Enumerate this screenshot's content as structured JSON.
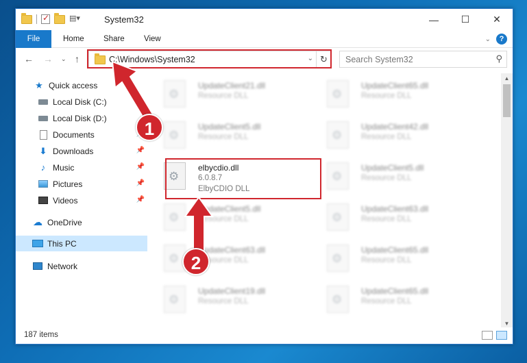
{
  "window": {
    "title": "System32",
    "controls": [
      "minimize-icon",
      "maximize-icon",
      "close-icon"
    ]
  },
  "ribbon": {
    "tabs": [
      "File",
      "Home",
      "Share",
      "View"
    ]
  },
  "address_bar": {
    "path": "C:\\Windows\\System32",
    "search_placeholder": "Search System32"
  },
  "sidebar": {
    "items": [
      {
        "label": "Quick access",
        "icon": "star-icon",
        "pinned": false
      },
      {
        "label": "Local Disk (C:)",
        "icon": "drive-icon",
        "pinned": true
      },
      {
        "label": "Local Disk (D:)",
        "icon": "drive-icon",
        "pinned": false
      },
      {
        "label": "Documents",
        "icon": "documents-icon",
        "pinned": true
      },
      {
        "label": "Downloads",
        "icon": "downloads-icon",
        "pinned": true
      },
      {
        "label": "Music",
        "icon": "music-icon",
        "pinned": true
      },
      {
        "label": "Pictures",
        "icon": "pictures-icon",
        "pinned": true
      },
      {
        "label": "Videos",
        "icon": "videos-icon",
        "pinned": true
      },
      {
        "label": "OneDrive",
        "icon": "cloud-icon",
        "pinned": false
      },
      {
        "label": "This PC",
        "icon": "computer-icon",
        "pinned": false,
        "selected": true
      },
      {
        "label": "Network",
        "icon": "network-icon",
        "pinned": false
      }
    ]
  },
  "files": [
    {
      "name": "UpdateClient21.dll",
      "type": "Resource DLL",
      "blurred": true
    },
    {
      "name": "UpdateClient65.dll",
      "type": "Resource DLL",
      "blurred": true
    },
    {
      "name": "UpdateClient5.dll",
      "type": "Resource DLL",
      "blurred": true
    },
    {
      "name": "UpdateClient42.dll",
      "type": "Resource DLL",
      "blurred": true
    },
    {
      "name": "elbycdio.dll",
      "version": "6.0.8.7",
      "type": "ElbyCDIO DLL",
      "blurred": false,
      "highlighted": true
    },
    {
      "name": "UpdateClient5.dll",
      "type": "Resource DLL",
      "blurred": true
    },
    {
      "name": "UpdateClient5.dll",
      "type": "Resource DLL",
      "blurred": true
    },
    {
      "name": "UpdateClient63.dll",
      "type": "Resource DLL",
      "blurred": true
    },
    {
      "name": "UpdateClient63.dll",
      "type": "Resource DLL",
      "blurred": true
    },
    {
      "name": "UpdateClient65.dll",
      "type": "Resource DLL",
      "blurred": true
    },
    {
      "name": "UpdateClient19.dll",
      "type": "Resource DLL",
      "blurred": true
    },
    {
      "name": "UpdateClient65.dll",
      "type": "Resource DLL",
      "blurred": true
    }
  ],
  "status": {
    "item_count": "187 items"
  },
  "annotations": {
    "badge_1": "1",
    "badge_2": "2",
    "highlight_color": "#d0262d"
  },
  "colors": {
    "accent": "#1979ca",
    "selected_bg": "#cce8ff"
  }
}
